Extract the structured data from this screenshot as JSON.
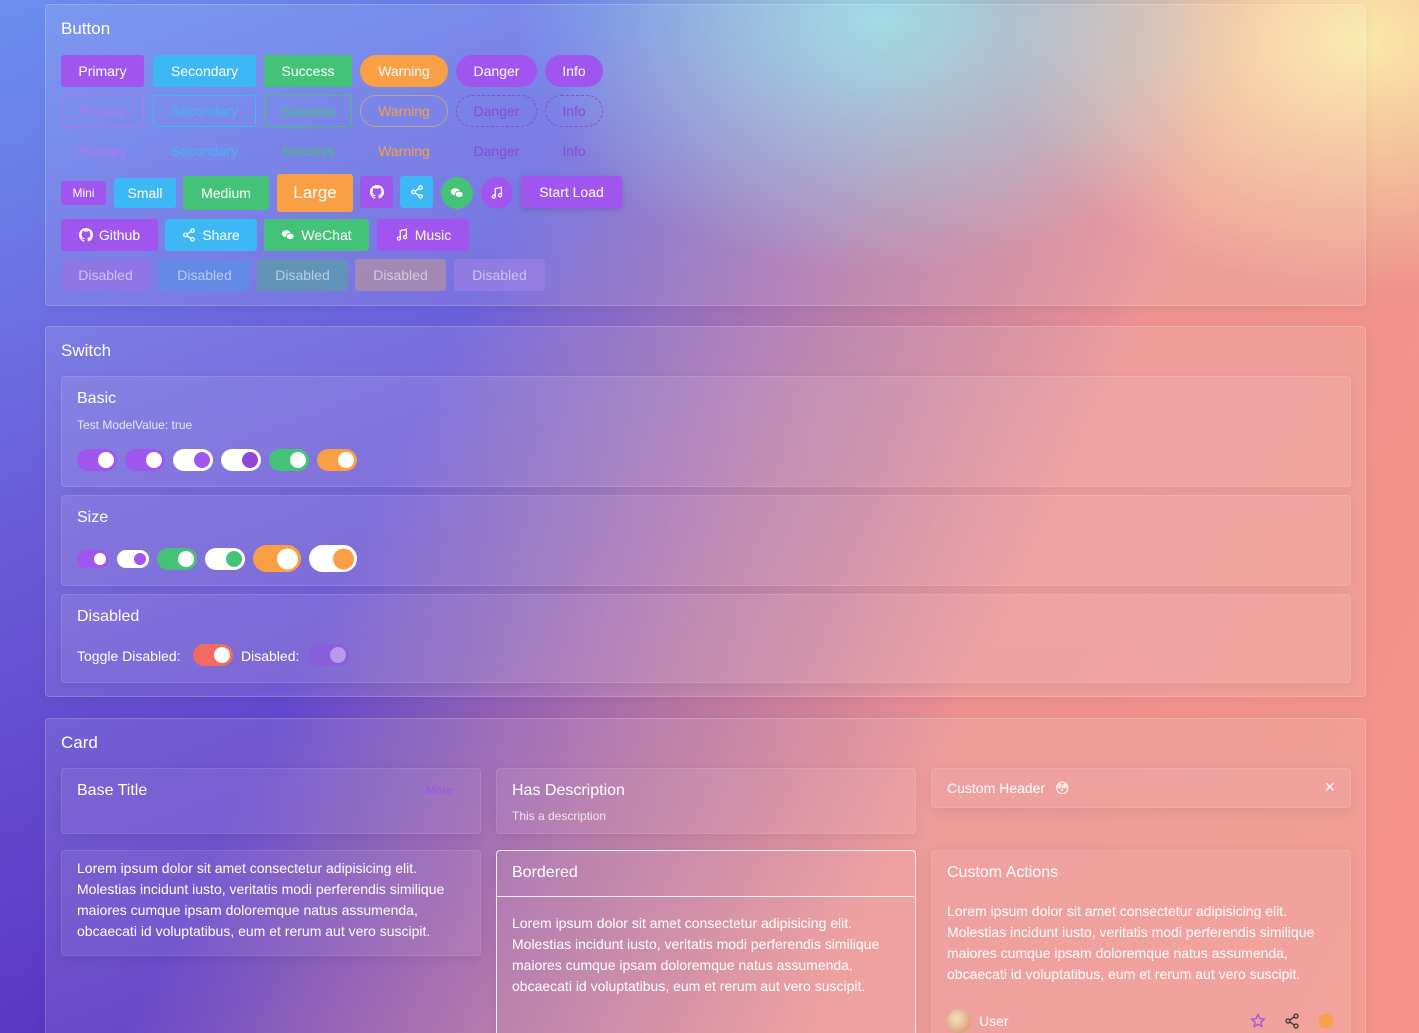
{
  "colors": {
    "primary": "#a056ee",
    "secondary": "#3eb8f4",
    "success": "#44c378",
    "warning": "#f99f45",
    "danger": "#f26b62"
  },
  "button_section": {
    "title": "Button",
    "solid": [
      "Primary",
      "Secondary",
      "Success",
      "Warning",
      "Danger",
      "Info"
    ],
    "plain": [
      "Primary",
      "Secondary",
      "Success",
      "Warning",
      "Danger",
      "Info"
    ],
    "text": [
      "Primary",
      "Secondary",
      "Success",
      "Warning",
      "Danger",
      "Info"
    ],
    "sizes": [
      "Mini",
      "Small",
      "Medium",
      "Large"
    ],
    "icon_buttons": [
      "github-icon",
      "share-icon",
      "wechat-icon",
      "music-icon"
    ],
    "start_load": "Start Load",
    "with_icons": [
      "Github",
      "Share",
      "WeChat",
      "Music"
    ],
    "disabled": [
      "Disabled",
      "Disabled",
      "Disabled",
      "Disabled",
      "Disabled"
    ]
  },
  "switch_section": {
    "title": "Switch",
    "basic": {
      "title": "Basic",
      "note": "Test ModelValue: true"
    },
    "size": {
      "title": "Size"
    },
    "disabled": {
      "title": "Disabled",
      "toggle_label": "Toggle Disabled:",
      "disabled_label": "Disabled:"
    }
  },
  "card_section": {
    "title": "Card",
    "base": {
      "title": "Base Title",
      "more": "More"
    },
    "desc": {
      "title": "Has Description",
      "description": "This a description"
    },
    "custom_header": {
      "title": "Custom Header",
      "emoji": "😳",
      "close": "×"
    },
    "lorem": "Lorem ipsum dolor sit amet consectetur adipisicing elit. Molestias incidunt iusto, veritatis modi perferendis similique maiores cumque ipsam doloremque natus assumenda, obcaecati id voluptatibus, eum et rerum aut vero suscipit.",
    "bordered": {
      "title": "Bordered"
    },
    "actions": {
      "title": "Custom Actions",
      "user": "User"
    }
  }
}
